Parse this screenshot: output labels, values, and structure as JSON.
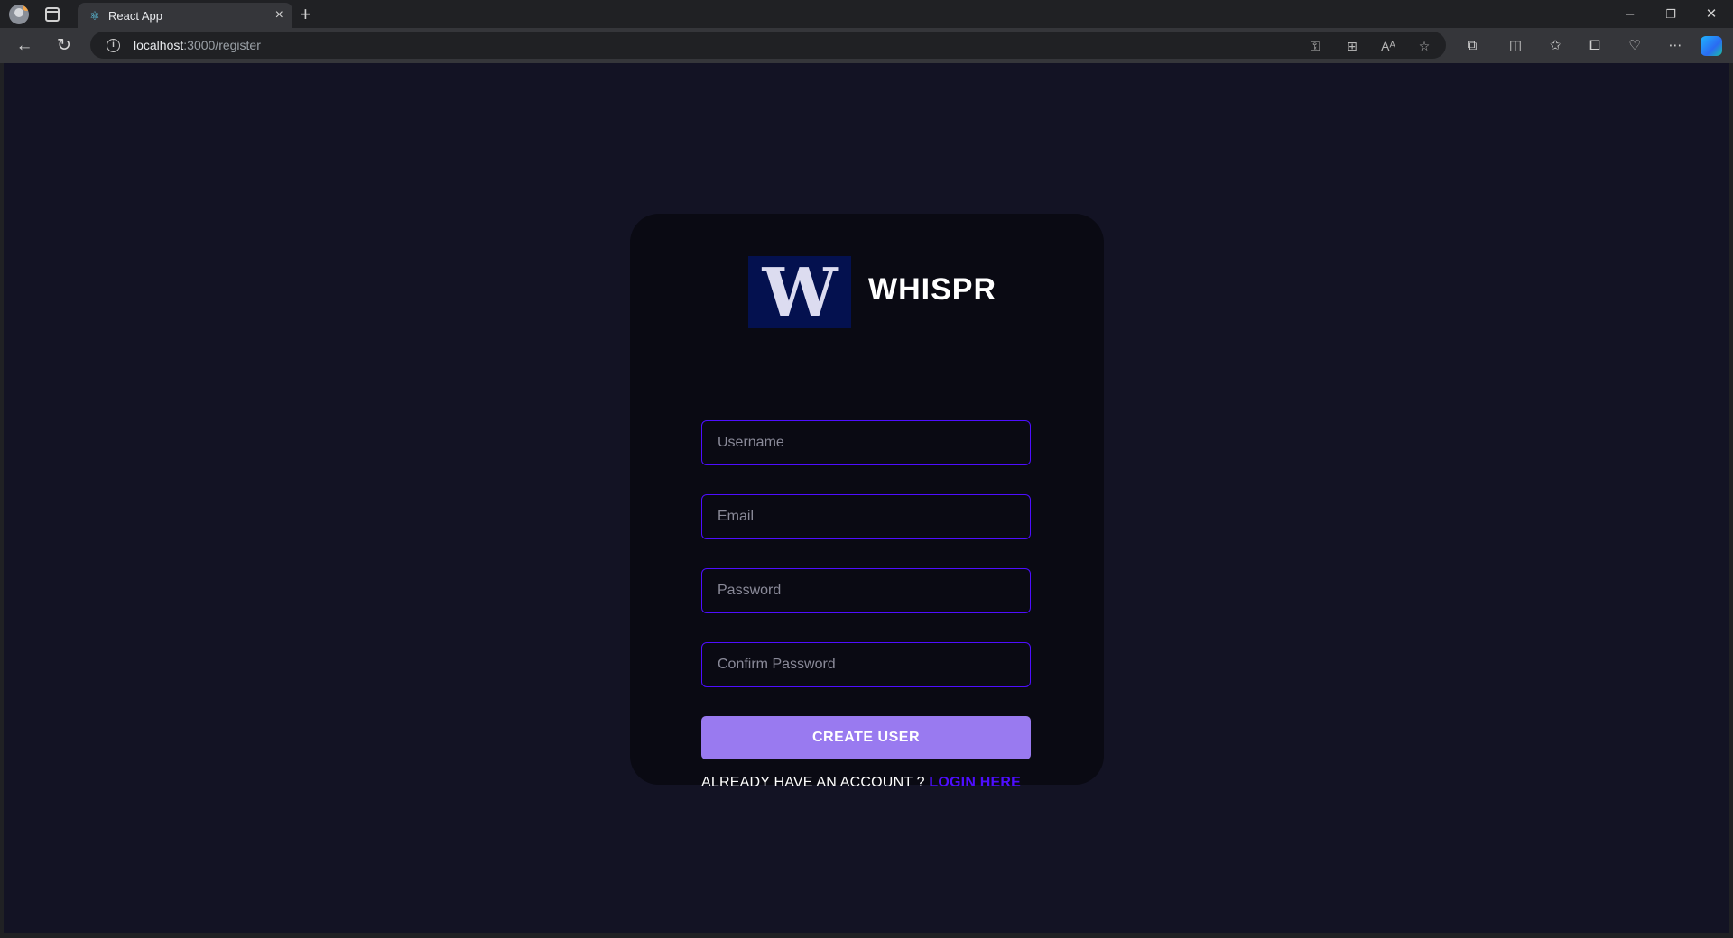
{
  "browser": {
    "tab": {
      "title": "React App",
      "favicon": "react-icon"
    },
    "new_tab_label": "+",
    "window_controls": {
      "minimize": "–",
      "restore": "❐",
      "close": "✕"
    },
    "nav": {
      "back": "←",
      "reload": "↻"
    },
    "address_bar": {
      "host": "localhost",
      "rest": ":3000/register"
    },
    "toolbar_icons": [
      "key-icon",
      "apps-icon",
      "read-aloud-icon",
      "favorite-star-icon",
      "extensions-icon",
      "split-screen-icon",
      "favorites-icon",
      "collections-icon",
      "performance-icon",
      "more-icon",
      "copilot-icon"
    ]
  },
  "page": {
    "background": "#131324",
    "card_background": "#0a0a13",
    "accent": "#4e0eff",
    "button_color": "#997af0",
    "brand": {
      "logo_letter": "W",
      "name": "WHISPR",
      "logo_background": "#04114f"
    },
    "form": {
      "username_placeholder": "Username",
      "email_placeholder": "Email",
      "password_placeholder": "Password",
      "confirm_password_placeholder": "Confirm Password",
      "submit_label": "Create User"
    },
    "footer": {
      "prompt": "Already have an account ? ",
      "link_label": "Login Here"
    }
  }
}
